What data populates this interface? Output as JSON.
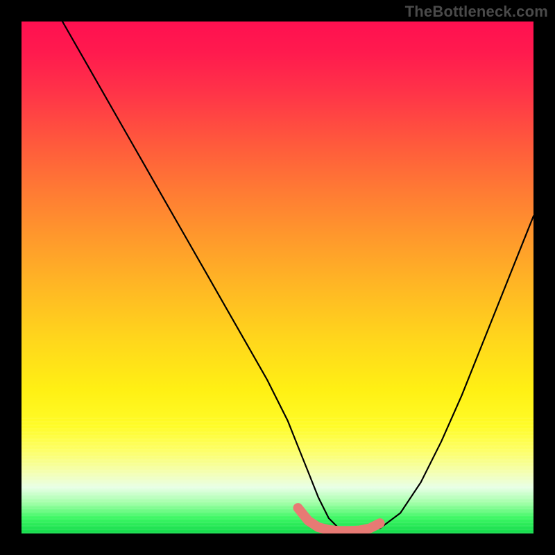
{
  "watermark": "TheBottleneck.com",
  "chart_data": {
    "type": "line",
    "title": "",
    "xlabel": "",
    "ylabel": "",
    "xlim": [
      0,
      100
    ],
    "ylim": [
      0,
      100
    ],
    "grid": false,
    "series": [
      {
        "name": "main-curve",
        "color": "#000000",
        "x": [
          8,
          12,
          16,
          20,
          24,
          28,
          32,
          36,
          40,
          44,
          48,
          52,
          54,
          56,
          58,
          60,
          62,
          64,
          66,
          70,
          74,
          78,
          82,
          86,
          90,
          94,
          98,
          100
        ],
        "y": [
          100,
          93,
          86,
          79,
          72,
          65,
          58,
          51,
          44,
          37,
          30,
          22,
          17,
          12,
          7,
          3,
          1,
          0.5,
          0.5,
          1,
          4,
          10,
          18,
          27,
          37,
          47,
          57,
          62
        ]
      },
      {
        "name": "valley-highlight",
        "color": "#e77a74",
        "x": [
          54,
          56,
          58,
          60,
          62,
          64,
          66,
          68,
          70
        ],
        "y": [
          5,
          2.5,
          1.2,
          0.7,
          0.5,
          0.5,
          0.6,
          1.0,
          2.0
        ]
      }
    ],
    "background_gradient": {
      "top": "#ff1050",
      "mid": "#ffd61c",
      "bottom": "#12d94a"
    }
  }
}
